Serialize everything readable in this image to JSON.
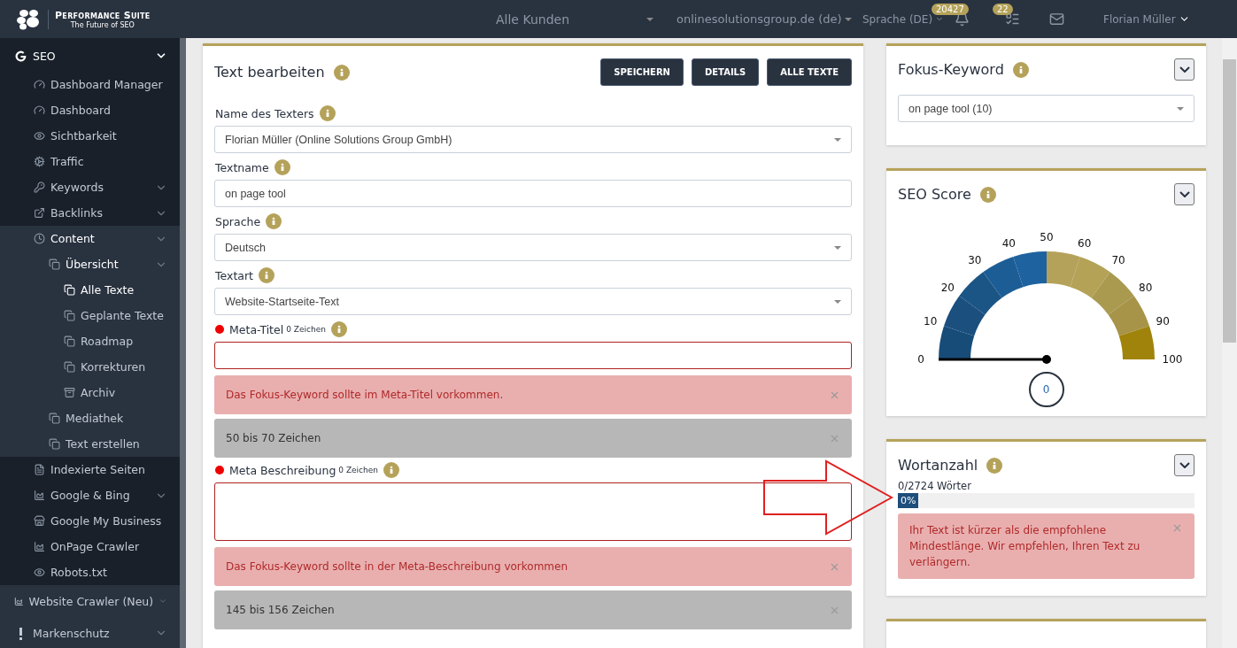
{
  "topbar": {
    "brand": "Performance Suite",
    "tagline": "The Future of SEO",
    "customer": "Alle Kunden",
    "domain": "onlinesolutionsgroup.de (de)",
    "language": "Sprache (DE)",
    "notifications": "20427",
    "tasks": "22",
    "user": "Florian Müller"
  },
  "sidebar": {
    "items": [
      {
        "label": "SEO",
        "expanded": true,
        "selected": false,
        "children": [
          {
            "label": "Dashboard Manager",
            "selected": false
          },
          {
            "label": "Dashboard",
            "selected": false
          },
          {
            "label": "Sichtbarkeit",
            "selected": false
          },
          {
            "label": "Traffic",
            "selected": false
          },
          {
            "label": "Keywords",
            "expanded": false,
            "selected": false
          },
          {
            "label": "Backlinks",
            "expanded": false,
            "selected": false
          },
          {
            "label": "Content",
            "expanded": true,
            "selected": false,
            "children": [
              {
                "label": "Übersicht",
                "expanded": true,
                "selected": false,
                "children": [
                  {
                    "label": "Alle Texte",
                    "selected": true
                  },
                  {
                    "label": "Geplante Texte",
                    "selected": false
                  },
                  {
                    "label": "Roadmap",
                    "selected": false
                  },
                  {
                    "label": "Korrekturen",
                    "selected": false
                  },
                  {
                    "label": "Archiv",
                    "selected": false
                  }
                ]
              },
              {
                "label": "Mediathek",
                "selected": false
              },
              {
                "label": "Text erstellen",
                "selected": false
              }
            ]
          },
          {
            "label": "Indexierte Seiten",
            "selected": false
          },
          {
            "label": "Google & Bing",
            "expanded": false,
            "selected": false
          },
          {
            "label": "Google My Business",
            "selected": false
          },
          {
            "label": "OnPage Crawler",
            "selected": false
          },
          {
            "label": "Robots.txt",
            "selected": false
          }
        ]
      },
      {
        "label": "Website Crawler (Neu)",
        "expanded": false,
        "selected": false
      },
      {
        "label": "Markenschutz",
        "expanded": false,
        "selected": false
      }
    ]
  },
  "editor": {
    "title": "Text bearbeiten",
    "buttons": [
      "SPEICHERN",
      "DETAILS",
      "ALLE TEXTE"
    ],
    "fields": [
      {
        "kind": "select",
        "label": "Name des Texters",
        "value": "Florian Müller (Online Solutions Group GmbH)"
      },
      {
        "kind": "input",
        "label": "Textname",
        "value": "on page tool"
      },
      {
        "kind": "select",
        "label": "Sprache",
        "value": "Deutsch"
      },
      {
        "kind": "select",
        "label": "Textart",
        "value": "Website-Startseite-Text"
      },
      {
        "kind": "input",
        "label": "Meta-Titel",
        "counter": "0 Zeichen",
        "invalid": true,
        "alerts": [
          {
            "kind": "danger",
            "text": "Das Fokus-Keyword sollte im Meta-Titel vorkommen."
          },
          {
            "kind": "info",
            "text": "50 bis 70 Zeichen"
          }
        ]
      },
      {
        "kind": "textarea",
        "label": "Meta Beschreibung",
        "counter": "0 Zeichen",
        "invalid": true,
        "alerts": [
          {
            "kind": "danger",
            "text": "Das Fokus-Keyword sollte in der Meta-Beschreibung vorkommen"
          },
          {
            "kind": "info",
            "text": "145 bis 156 Zeichen"
          }
        ]
      }
    ]
  },
  "focus_keyword": {
    "title": "Fokus-Keyword",
    "value": "on page tool (10)"
  },
  "seo_score": {
    "title": "SEO Score",
    "ticks": [
      "0",
      "10",
      "20",
      "30",
      "40",
      "50",
      "60",
      "70",
      "80",
      "90",
      "100"
    ],
    "value": "0"
  },
  "word_count": {
    "title": "Wortanzahl",
    "reading": "0/2724 Wörter",
    "level": 0,
    "percent": "0%",
    "alert": "Ihr Text ist kürzer als die empfohlene Mindestlänge. Wir empfehlen, Ihren Text zu verlängern."
  }
}
